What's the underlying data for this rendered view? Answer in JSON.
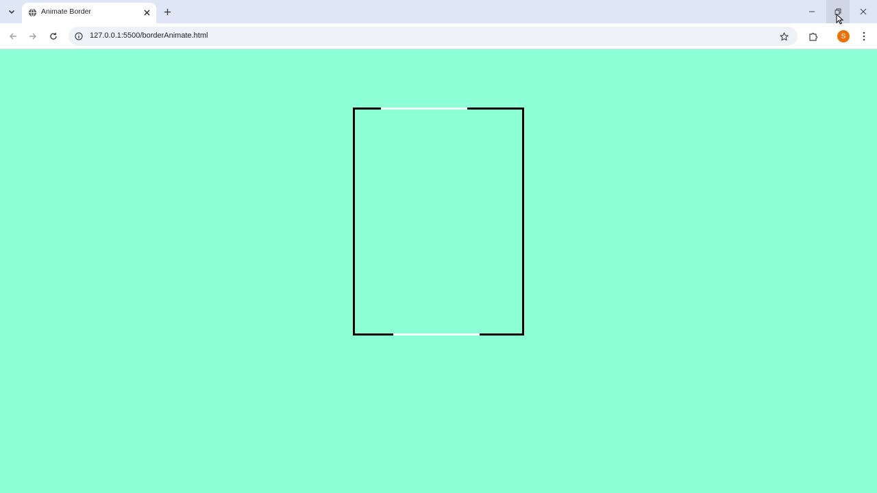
{
  "browser": {
    "tab": {
      "title": "Animate Border",
      "favicon": "globe-icon"
    },
    "toolbar": {
      "url": "127.0.0.1:5500/borderAnimate.html",
      "profile_initial": "S"
    }
  },
  "colors": {
    "page_background": "#8cffd6",
    "box_border": "#000000",
    "border_highlight": "#f3fff9",
    "profile_avatar": "#e8710a"
  }
}
